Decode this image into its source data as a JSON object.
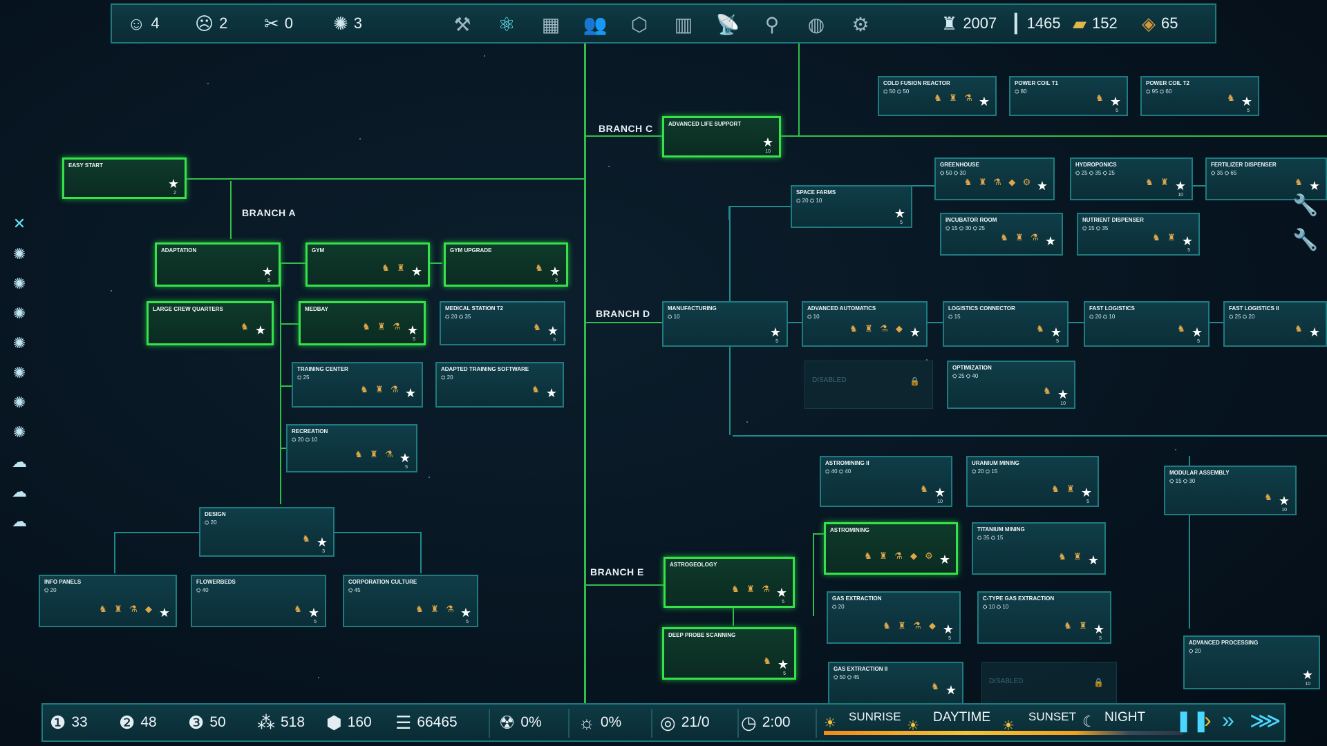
{
  "topbar": {
    "happy": "4",
    "sad": "2",
    "food": "0",
    "ideas": "3",
    "tools": [
      {
        "name": "build-icon",
        "glyph": "⚒",
        "active": false
      },
      {
        "name": "research-icon",
        "glyph": "⚛",
        "active": true
      },
      {
        "name": "storage-icon",
        "glyph": "▦",
        "active": false
      },
      {
        "name": "crew-icon",
        "glyph": "👥",
        "active": false
      },
      {
        "name": "modules-icon",
        "glyph": "⬡",
        "active": false
      },
      {
        "name": "stats-icon",
        "glyph": "▥",
        "active": false
      },
      {
        "name": "satellite-icon",
        "glyph": "📡",
        "active": false
      },
      {
        "name": "network-icon",
        "glyph": "⚲",
        "active": false
      },
      {
        "name": "planet-icon",
        "glyph": "◍",
        "active": false
      },
      {
        "name": "gear-icon",
        "glyph": "⚙",
        "active": false
      }
    ],
    "res1": "2007",
    "res2": "1465",
    "res3": "152",
    "res4": "65"
  },
  "branches": {
    "a": "BRANCH A",
    "c": "BRANCH C",
    "d": "BRANCH D",
    "e": "BRANCH E"
  },
  "nodes": [
    {
      "id": "easy-start",
      "title": "EASY START",
      "costs": "",
      "lvl": "2",
      "state": "done",
      "items": 0
    },
    {
      "id": "adaptation",
      "title": "ADAPTATION",
      "costs": "",
      "lvl": "5",
      "state": "done",
      "items": 0
    },
    {
      "id": "gym",
      "title": "GYM",
      "costs": "",
      "lvl": "",
      "state": "done",
      "items": 2
    },
    {
      "id": "gym-upgrade",
      "title": "GYM UPGRADE",
      "costs": "",
      "lvl": "5",
      "state": "done",
      "items": 1
    },
    {
      "id": "large-crew-quarters",
      "title": "LARGE CREW QUARTERS",
      "costs": "",
      "lvl": "",
      "state": "done",
      "items": 1
    },
    {
      "id": "medbay",
      "title": "MEDBAY",
      "costs": "",
      "lvl": "5",
      "state": "done",
      "items": 3
    },
    {
      "id": "medical-station-t2",
      "title": "MEDICAL STATION T2",
      "costs": "⛭ 20  ⛭ 35",
      "lvl": "5",
      "state": "normal",
      "items": 1
    },
    {
      "id": "training-center",
      "title": "TRAINING CENTER",
      "costs": "⛭ 25",
      "lvl": "",
      "state": "normal",
      "items": 3
    },
    {
      "id": "adapted-training-software",
      "title": "ADAPTED TRAINING SOFTWARE",
      "costs": "⛭ 20",
      "lvl": "",
      "state": "normal",
      "items": 1
    },
    {
      "id": "recreation",
      "title": "RECREATION",
      "costs": "⛭ 20  ⛭ 10",
      "lvl": "5",
      "state": "normal",
      "items": 3
    },
    {
      "id": "design",
      "title": "DESIGN",
      "costs": "⛭ 20",
      "lvl": "3",
      "state": "normal",
      "items": 1
    },
    {
      "id": "info-panels",
      "title": "INFO PANELS",
      "costs": "⛭ 20",
      "lvl": "",
      "state": "normal",
      "items": 4
    },
    {
      "id": "flowerbeds",
      "title": "FLOWERBEDS",
      "costs": "⛭ 40",
      "lvl": "5",
      "state": "normal",
      "items": 1
    },
    {
      "id": "corporation-culture",
      "title": "CORPORATION CULTURE",
      "costs": "⛭ 45",
      "lvl": "5",
      "state": "normal",
      "items": 3
    },
    {
      "id": "advanced-life-support",
      "title": "ADVANCED LIFE SUPPORT",
      "costs": "",
      "lvl": "10",
      "state": "done",
      "items": 0
    },
    {
      "id": "cold-fusion-reactor",
      "title": "COLD FUSION REACTOR",
      "costs": "⛭ 50  ⛭ 50",
      "lvl": "",
      "state": "normal",
      "items": 3
    },
    {
      "id": "power-coil-t1",
      "title": "POWER COIL T1",
      "costs": "⛭ 80",
      "lvl": "5",
      "state": "normal",
      "items": 1
    },
    {
      "id": "power-coil-t2",
      "title": "POWER COIL T2",
      "costs": "⛭ 95  ⛭ 60",
      "lvl": "5",
      "state": "normal",
      "items": 1
    },
    {
      "id": "space-farms",
      "title": "SPACE FARMS",
      "costs": "⛭ 20  ⛭ 10",
      "lvl": "5",
      "state": "normal",
      "items": 0
    },
    {
      "id": "greenhouse",
      "title": "GREENHOUSE",
      "costs": "⛭ 50  ⛭ 30",
      "lvl": "",
      "state": "normal",
      "items": 5
    },
    {
      "id": "hydroponics",
      "title": "HYDROPONICS",
      "costs": "⛭ 25  ⛭ 35  ⛭ 25",
      "lvl": "10",
      "state": "normal",
      "items": 2
    },
    {
      "id": "fertilizer-dispenser",
      "title": "FERTILIZER DISPENSER",
      "costs": "⛭ 35  ⛭ 65",
      "lvl": "",
      "state": "normal",
      "items": 1
    },
    {
      "id": "incubator-room",
      "title": "INCUBATOR ROOM",
      "costs": "⛭ 15  ⛭ 30  ⛭ 25",
      "lvl": "",
      "state": "normal",
      "items": 3
    },
    {
      "id": "nutrient-dispenser",
      "title": "NUTRIENT DISPENSER",
      "costs": "⛭ 15  ⛭ 35",
      "lvl": "5",
      "state": "normal",
      "items": 2
    },
    {
      "id": "manufacturing",
      "title": "MANUFACTURING",
      "costs": "⛭ 10",
      "lvl": "5",
      "state": "normal",
      "items": 0
    },
    {
      "id": "advanced-automatics",
      "title": "ADVANCED AUTOMATICS",
      "costs": "⛭ 10",
      "lvl": "",
      "state": "normal",
      "items": 4
    },
    {
      "id": "logistics-connector",
      "title": "LOGISTICS CONNECTOR",
      "costs": "⛭ 15",
      "lvl": "5",
      "state": "normal",
      "items": 1
    },
    {
      "id": "fast-logistics",
      "title": "FAST LOGISTICS",
      "costs": "⛭ 20  ⛭ 10",
      "lvl": "5",
      "state": "normal",
      "items": 1
    },
    {
      "id": "fast-logistics-ii",
      "title": "FAST LOGISTICS II",
      "costs": "⛭ 25  ⛭ 20",
      "lvl": "",
      "state": "normal",
      "items": 1
    },
    {
      "id": "disabled-1",
      "title": "",
      "costs": "",
      "lvl": "",
      "state": "disabled",
      "items": 0,
      "disabled_text": "DISABLED"
    },
    {
      "id": "optimization",
      "title": "OPTIMIZATION",
      "costs": "⛭ 25  ⛭ 40",
      "lvl": "10",
      "state": "normal",
      "items": 1
    },
    {
      "id": "astromining-ii",
      "title": "ASTROMINING II",
      "costs": "⛭ 40  ⛭ 40",
      "lvl": "10",
      "state": "normal",
      "items": 1
    },
    {
      "id": "uranium-mining",
      "title": "URANIUM MINING",
      "costs": "⛭ 20  ⛭ 15",
      "lvl": "5",
      "state": "normal",
      "items": 2
    },
    {
      "id": "modular-assembly",
      "title": "MODULAR ASSEMBLY",
      "costs": "⛭ 15  ⛭ 30",
      "lvl": "10",
      "state": "normal",
      "items": 1
    },
    {
      "id": "astrogeology",
      "title": "ASTROGEOLOGY",
      "costs": "",
      "lvl": "5",
      "state": "done",
      "items": 3
    },
    {
      "id": "astromining",
      "title": "ASTROMINING",
      "costs": "",
      "lvl": "",
      "state": "done",
      "items": 5
    },
    {
      "id": "titanium-mining",
      "title": "TITANIUM MINING",
      "costs": "⛭ 35  ⛭ 15",
      "lvl": "",
      "state": "normal",
      "items": 2
    },
    {
      "id": "deep-probe-scanning",
      "title": "DEEP PROBE SCANNING",
      "costs": "",
      "lvl": "5",
      "state": "done",
      "items": 1
    },
    {
      "id": "gas-extraction",
      "title": "GAS EXTRACTION",
      "costs": "⛭ 20",
      "lvl": "5",
      "state": "normal",
      "items": 4
    },
    {
      "id": "c-type-gas-extraction",
      "title": "C-TYPE GAS EXTRACTION",
      "costs": "⛭ 10  ⛭ 10",
      "lvl": "5",
      "state": "normal",
      "items": 2
    },
    {
      "id": "advanced-processing",
      "title": "ADVANCED PROCESSING",
      "costs": "⛭ 20",
      "lvl": "10",
      "state": "normal",
      "items": 0
    },
    {
      "id": "gas-extraction-ii",
      "title": "GAS EXTRACTION II",
      "costs": "⛭ 50  ⛭ 45",
      "lvl": "",
      "state": "normal",
      "items": 1
    },
    {
      "id": "disabled-2",
      "title": "",
      "costs": "",
      "lvl": "",
      "state": "disabled",
      "items": 0,
      "disabled_text": "DISABLED"
    }
  ],
  "bottombar": {
    "tier1": "33",
    "tier2": "48",
    "tier3": "50",
    "molecules": "518",
    "shield": "160",
    "money": "66465",
    "radiation": "0%",
    "solar": "0%",
    "cycle": "21/0",
    "time": "2:00",
    "day_phases": {
      "sunrise": "SUNRISE",
      "daytime": "DAYTIME",
      "sunset": "SUNSET",
      "night": "NIGHT"
    }
  },
  "colors": {
    "accent": "#2fc04a",
    "frame": "#1e7a7e",
    "bg": "#071521"
  }
}
